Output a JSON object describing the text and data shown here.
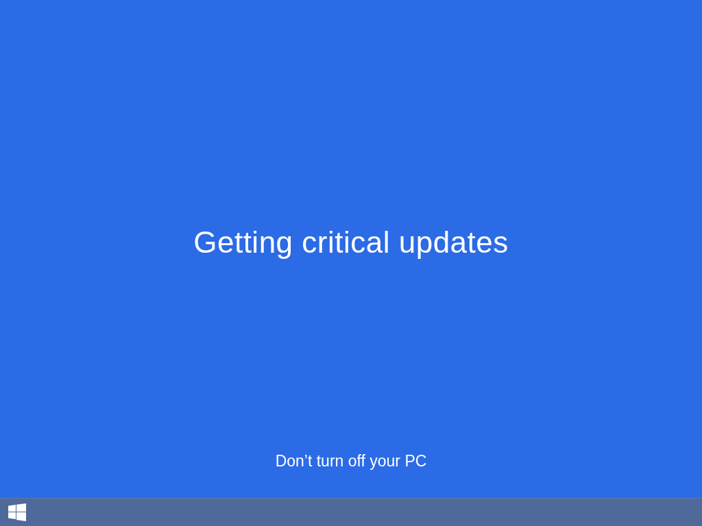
{
  "screen": {
    "heading": "Getting critical updates",
    "subtitle": "Don’t turn off your PC"
  }
}
